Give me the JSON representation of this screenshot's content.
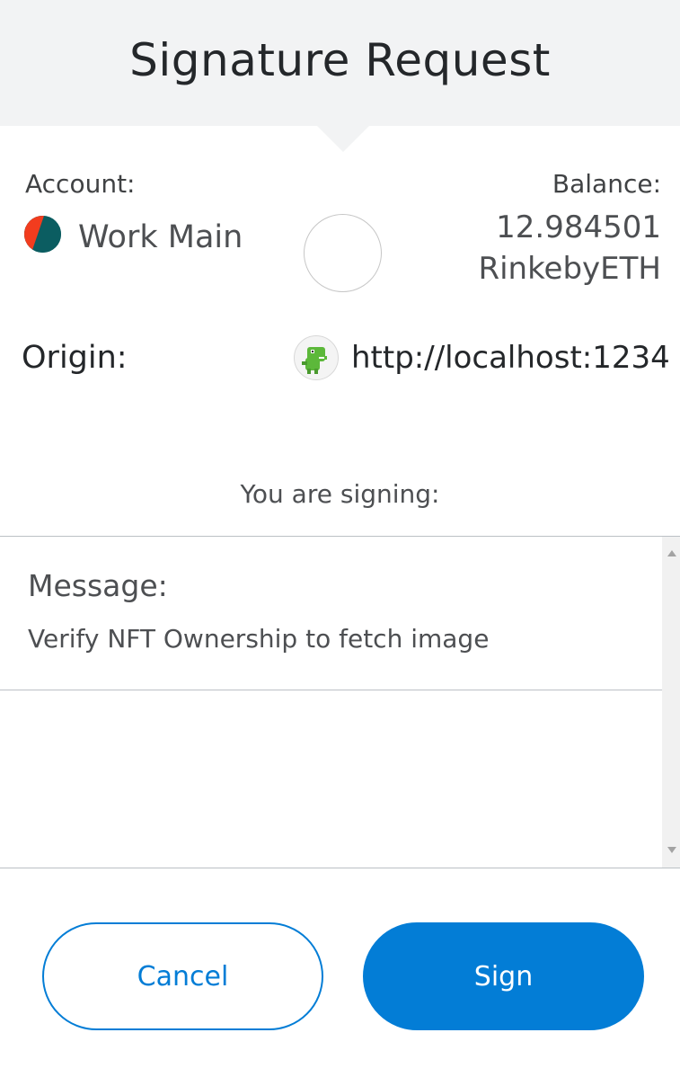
{
  "header": {
    "title": "Signature Request"
  },
  "account": {
    "label": "Account:",
    "name": "Work Main"
  },
  "balance": {
    "label": "Balance:",
    "amount": "12.984501",
    "unit": "RinkebyETH"
  },
  "origin": {
    "label": "Origin:",
    "url": "http://localhost:1234",
    "icon": "dino-icon"
  },
  "signing": {
    "label": "You are signing:"
  },
  "message": {
    "label": "Message:",
    "value": "Verify NFT Ownership to fetch image"
  },
  "actions": {
    "cancel_label": "Cancel",
    "sign_label": "Sign"
  },
  "colors": {
    "accent": "#037dd6",
    "header_bg": "#f2f3f4"
  }
}
